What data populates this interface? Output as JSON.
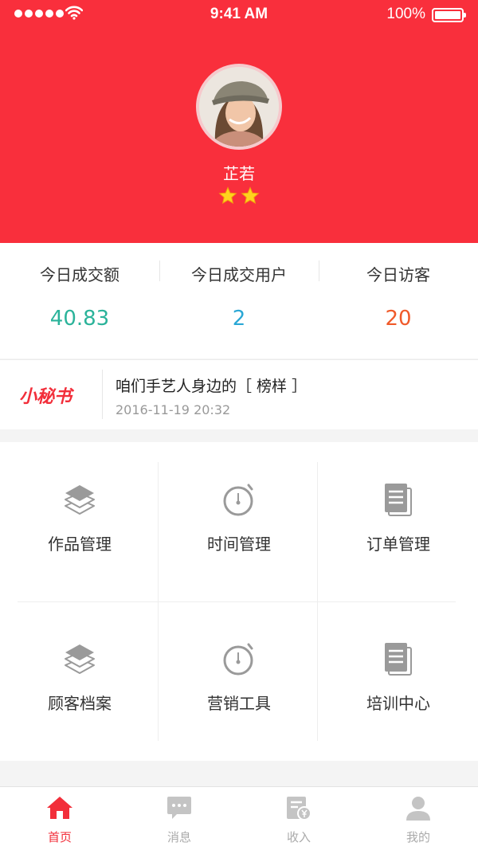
{
  "status_bar": {
    "time": "9:41 AM",
    "battery": "100%"
  },
  "profile": {
    "name": "芷若",
    "rating": 2
  },
  "stats": [
    {
      "label": "今日成交额",
      "value": "40.83",
      "color": "#2bb39a"
    },
    {
      "label": "今日成交用户",
      "value": "2",
      "color": "#2aa7d5"
    },
    {
      "label": "今日访客",
      "value": "20",
      "color": "#f05a2a"
    }
  ],
  "notice": {
    "brand": "小秘书",
    "title": "咱们手艺人身边的［ 榜样 ］",
    "time": "2016-11-19 20:32"
  },
  "menu": [
    {
      "label": "作品管理",
      "icon": "layers-icon"
    },
    {
      "label": "时间管理",
      "icon": "stopwatch-icon"
    },
    {
      "label": "订单管理",
      "icon": "document-icon"
    },
    {
      "label": "顾客档案",
      "icon": "layers-icon"
    },
    {
      "label": "营销工具",
      "icon": "stopwatch-icon"
    },
    {
      "label": "培训中心",
      "icon": "document-icon"
    }
  ],
  "tabs": [
    {
      "label": "首页",
      "icon": "home-icon",
      "active": true
    },
    {
      "label": "消息",
      "icon": "message-icon",
      "active": false
    },
    {
      "label": "收入",
      "icon": "income-icon",
      "active": false
    },
    {
      "label": "我的",
      "icon": "user-icon",
      "active": false
    }
  ],
  "colors": {
    "brand": "#f92f3c",
    "accent": "#f22e3a",
    "icon_gray": "#9a9a9a",
    "tab_inactive": "#c4c4c4"
  }
}
